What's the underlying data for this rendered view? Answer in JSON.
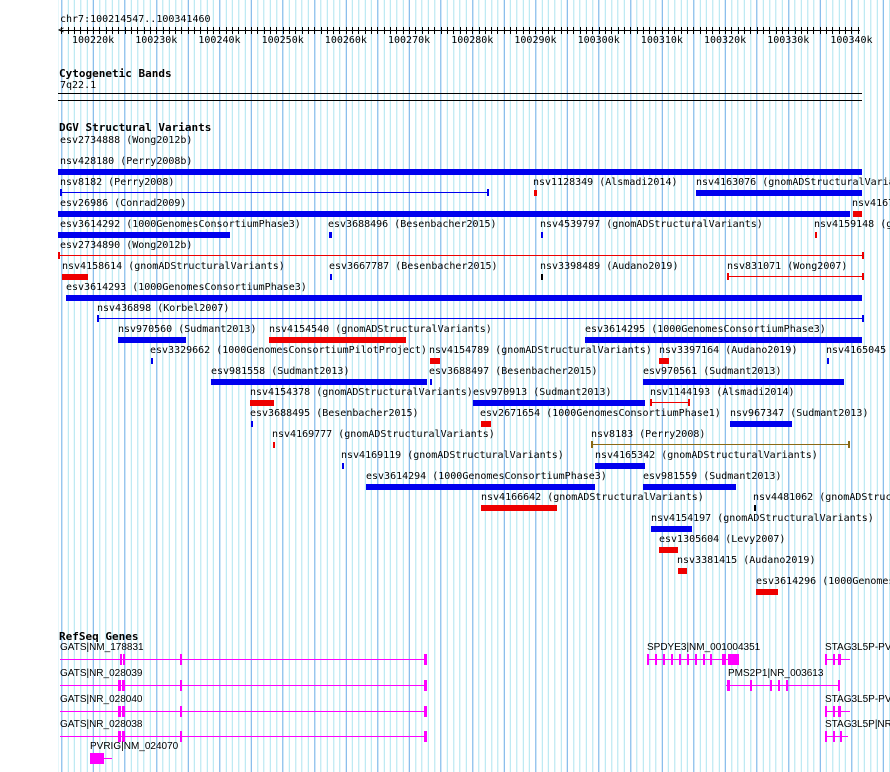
{
  "ruler": {
    "location": "chr7:100214547..100341460",
    "ticks": [
      "100220k",
      "100230k",
      "100240k",
      "100250k",
      "100260k",
      "100270k",
      "100280k",
      "100290k",
      "100300k",
      "100310k",
      "100320k",
      "100330k",
      "100340k"
    ]
  },
  "cytoband": {
    "title": "Cytogenetic Bands",
    "band": "7q22.1"
  },
  "dgv": {
    "title": "DGV Structural Variants",
    "colors": {
      "blue": "#0000ee",
      "red": "#ee0000",
      "black": "#000000",
      "olive": "#8b6914"
    },
    "features": [
      {
        "label": "esv2734888 (Wong2012b)"
      },
      {
        "label": "nsv428180 (Perry2008b)"
      },
      {
        "label": "nsv8182 (Perry2008)"
      },
      {
        "label": "nsv1128349 (Alsmadi2014)"
      },
      {
        "label": "nsv4163076 (gnomADStructuralVaria"
      },
      {
        "label": "esv26986 (Conrad2009)"
      },
      {
        "label": "nsv4167"
      },
      {
        "label": "esv3614292 (1000GenomesConsortiumPhase3)"
      },
      {
        "label": "esv3688496 (Besenbacher2015)"
      },
      {
        "label": "nsv4539797 (gnomADStructuralVariants)"
      },
      {
        "label": "nsv4159148 (g"
      },
      {
        "label": "esv2734890 (Wong2012b)"
      },
      {
        "label": "nsv4158614 (gnomADStructuralVariants)"
      },
      {
        "label": "esv3667787 (Besenbacher2015)"
      },
      {
        "label": "nsv3398489 (Audano2019)"
      },
      {
        "label": "nsv831071 (Wong2007)"
      },
      {
        "label": "esv3614293 (1000GenomesConsortiumPhase3)"
      },
      {
        "label": "nsv436898 (Korbel2007)"
      },
      {
        "label": "nsv970560 (Sudmant2013)"
      },
      {
        "label": "nsv4154540 (gnomADStructuralVariants)"
      },
      {
        "label": "esv3614295 (1000GenomesConsortiumPhase3)"
      },
      {
        "label": "esv3329662 (1000GenomesConsortiumPilotProject)"
      },
      {
        "label": "nsv4154789 (gnomADStructuralVariants)"
      },
      {
        "label": "nsv3397164 (Audano2019)"
      },
      {
        "label": "nsv4165045"
      },
      {
        "label": "esv981558 (Sudmant2013)"
      },
      {
        "label": "esv3688497 (Besenbacher2015)"
      },
      {
        "label": "esv970561 (Sudmant2013)"
      },
      {
        "label": "nsv4154378 (gnomADStructuralVariants)"
      },
      {
        "label": "esv970913 (Sudmant2013)"
      },
      {
        "label": "nsv1144193 (Alsmadi2014)"
      },
      {
        "label": "esv3688495 (Besenbacher2015)"
      },
      {
        "label": "esv2671654 (1000GenomesConsortiumPhase1)"
      },
      {
        "label": "nsv967347 (Sudmant2013)"
      },
      {
        "label": "nsv4169777 (gnomADStructuralVariants)"
      },
      {
        "label": "nsv8183 (Perry2008)"
      },
      {
        "label": "nsv4169119 (gnomADStructuralVariants)"
      },
      {
        "label": "nsv4165342 (gnomADStructuralVariants)"
      },
      {
        "label": "esv3614294 (1000GenomesConsortiumPhase3)"
      },
      {
        "label": "esv981559 (Sudmant2013)"
      },
      {
        "label": "nsv4166642 (gnomADStructuralVariants)"
      },
      {
        "label": "nsv4481062 (gnomADStructuralVariants"
      },
      {
        "label": "nsv4154197 (gnomADStructuralVariants)"
      },
      {
        "label": "esv1305604 (Levy2007)"
      },
      {
        "label": "nsv3381415 (Audano2019)"
      },
      {
        "label": "esv3614296 (1000Genomes"
      }
    ]
  },
  "refseq": {
    "title": "RefSeq Genes",
    "color": "#ff00ff",
    "genes": [
      {
        "label": "GATS|NM_178831"
      },
      {
        "label": "GATS|NR_028039"
      },
      {
        "label": "GATS|NR_028040"
      },
      {
        "label": "GATS|NR_028038"
      },
      {
        "label": "PVRIG|NM_024070"
      },
      {
        "label": "SPDYE3|NM_001004351"
      },
      {
        "label": "PMS2P1|NR_003613"
      },
      {
        "label": "STAG3L5P-PV"
      },
      {
        "label": "STAG3L5P-PV"
      },
      {
        "label": "STAG3L5P|NR"
      }
    ]
  }
}
